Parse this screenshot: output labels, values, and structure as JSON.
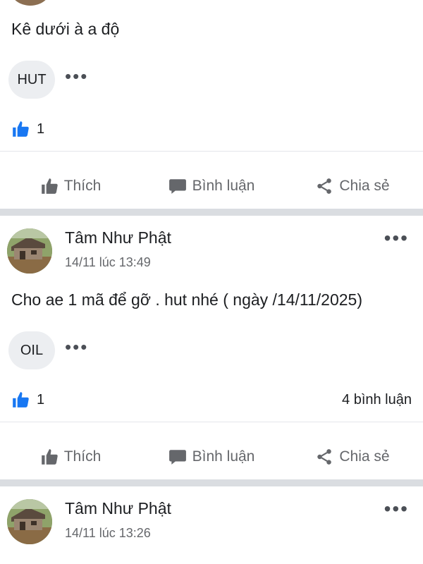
{
  "posts": [
    {
      "id": "partial-top",
      "text": "Kê dưới à a độ",
      "tag": "HUT",
      "likes": "1",
      "comments": "",
      "actions": {
        "like": "Thích",
        "comment": "Bình luận",
        "share": "Chia sẻ"
      }
    },
    {
      "id": "post-2",
      "author": "Tâm Như Phật",
      "time": "14/11 lúc 13:49",
      "text": "Cho ae 1 mã để gỡ . hut nhé ( ngày /14/11/2025)",
      "tag": "OIL",
      "likes": "1",
      "comments": "4 bình luận",
      "actions": {
        "like": "Thích",
        "comment": "Bình luận",
        "share": "Chia sẻ"
      }
    },
    {
      "id": "post-3",
      "author": "Tâm Như Phật",
      "time": "14/11 lúc 13:26"
    }
  ],
  "icons": {
    "more": "more-options-icon",
    "like_filled": "thumbs-up-filled-icon",
    "like_outline": "thumbs-up-icon",
    "comment": "comment-bubble-icon",
    "share": "share-icon"
  },
  "colors": {
    "like_blue": "#1877f2",
    "action_gray": "#65676b",
    "separator": "#dadde1",
    "chip_bg": "#eceef1"
  }
}
